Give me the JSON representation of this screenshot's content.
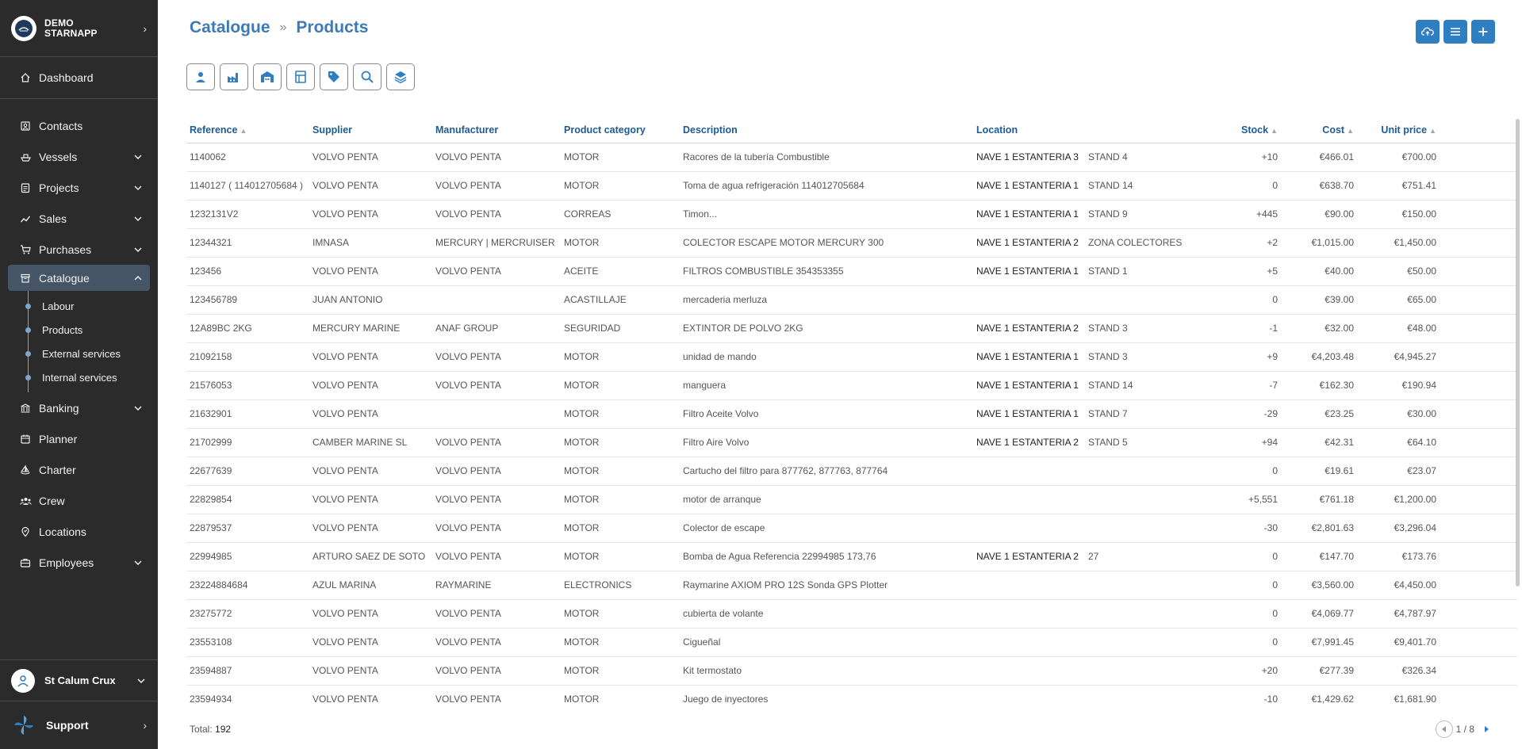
{
  "brand": {
    "name_line1": "DEMO",
    "name_line2": "STARNAPP"
  },
  "nav": {
    "dashboard": "Dashboard",
    "contacts": "Contacts",
    "vessels": "Vessels",
    "projects": "Projects",
    "sales": "Sales",
    "purchases": "Purchases",
    "catalogue": "Catalogue",
    "catalogue_sub": [
      "Labour",
      "Products",
      "External services",
      "Internal services"
    ],
    "banking": "Banking",
    "planner": "Planner",
    "charter": "Charter",
    "crew": "Crew",
    "locations": "Locations",
    "employees": "Employees"
  },
  "user": {
    "name": "St Calum Crux"
  },
  "support": {
    "label": "Support"
  },
  "breadcrumb": {
    "parent": "Catalogue",
    "current": "Products"
  },
  "table": {
    "columns": {
      "reference": "Reference",
      "supplier": "Supplier",
      "manufacturer": "Manufacturer",
      "category": "Product category",
      "description": "Description",
      "location": "Location",
      "stock": "Stock",
      "cost": "Cost",
      "unit_price": "Unit price"
    },
    "rows": [
      {
        "ref": "1140062",
        "sup": "VOLVO PENTA",
        "man": "VOLVO PENTA",
        "cat": "MOTOR",
        "desc": "Racores de la tubería Combustible",
        "loc": "NAVE 1 ESTANTERIA 3",
        "stand": "STAND 4",
        "stock": "+10",
        "cost": "€466.01",
        "price": "€700.00"
      },
      {
        "ref": "1140127 ( 114012705684 )",
        "sup": "VOLVO PENTA",
        "man": "VOLVO PENTA",
        "cat": "MOTOR",
        "desc": "Toma de agua refrigeración 114012705684",
        "loc": "NAVE 1 ESTANTERIA 1",
        "stand": "STAND 14",
        "stock": "0",
        "cost": "€638.70",
        "price": "€751.41"
      },
      {
        "ref": "1232131V2",
        "sup": "VOLVO PENTA",
        "man": "VOLVO PENTA",
        "cat": "CORREAS",
        "desc": "Timon...",
        "loc": "NAVE 1 ESTANTERIA 1",
        "stand": "STAND 9",
        "stock": "+445",
        "cost": "€90.00",
        "price": "€150.00"
      },
      {
        "ref": "12344321",
        "sup": "IMNASA",
        "man": "MERCURY | MERCRUISER",
        "cat": "MOTOR",
        "desc": "COLECTOR ESCAPE MOTOR MERCURY 300",
        "loc": "NAVE 1 ESTANTERIA 2",
        "stand": "ZONA COLECTORES",
        "stock": "+2",
        "cost": "€1,015.00",
        "price": "€1,450.00"
      },
      {
        "ref": "123456",
        "sup": "VOLVO PENTA",
        "man": "VOLVO PENTA",
        "cat": "ACEITE",
        "desc": "FILTROS COMBUSTIBLE 354353355",
        "loc": "NAVE 1 ESTANTERIA 1",
        "stand": "STAND 1",
        "stock": "+5",
        "cost": "€40.00",
        "price": "€50.00"
      },
      {
        "ref": "123456789",
        "sup": "JUAN ANTONIO",
        "man": "",
        "cat": "ACASTILLAJE",
        "desc": "mercaderia merluza",
        "loc": "",
        "stand": "",
        "stock": "0",
        "cost": "€39.00",
        "price": "€65.00"
      },
      {
        "ref": "12A89BC 2KG",
        "sup": "MERCURY MARINE",
        "man": "ANAF GROUP",
        "cat": "SEGURIDAD",
        "desc": "EXTINTOR DE POLVO 2KG",
        "loc": "NAVE 1 ESTANTERIA 2",
        "stand": "STAND 3",
        "stock": "-1",
        "cost": "€32.00",
        "price": "€48.00"
      },
      {
        "ref": "21092158",
        "sup": "VOLVO PENTA",
        "man": "VOLVO PENTA",
        "cat": "MOTOR",
        "desc": "unidad de mando",
        "loc": "NAVE 1 ESTANTERIA 1",
        "stand": "STAND 3",
        "stock": "+9",
        "cost": "€4,203.48",
        "price": "€4,945.27"
      },
      {
        "ref": "21576053",
        "sup": "VOLVO PENTA",
        "man": "VOLVO PENTA",
        "cat": "MOTOR",
        "desc": "manguera",
        "loc": "NAVE 1 ESTANTERIA 1",
        "stand": "STAND 14",
        "stock": "-7",
        "cost": "€162.30",
        "price": "€190.94"
      },
      {
        "ref": "21632901",
        "sup": "VOLVO PENTA",
        "man": "",
        "cat": "MOTOR",
        "desc": "Filtro Aceite Volvo",
        "loc": "NAVE 1 ESTANTERIA 1",
        "stand": "STAND 7",
        "stock": "-29",
        "cost": "€23.25",
        "price": "€30.00"
      },
      {
        "ref": "21702999",
        "sup": "CAMBER MARINE SL",
        "man": "VOLVO PENTA",
        "cat": "MOTOR",
        "desc": "Filtro Aire Volvo",
        "loc": "NAVE 1 ESTANTERIA 2",
        "stand": "STAND 5",
        "stock": "+94",
        "cost": "€42.31",
        "price": "€64.10"
      },
      {
        "ref": "22677639",
        "sup": "VOLVO PENTA",
        "man": "VOLVO PENTA",
        "cat": "MOTOR",
        "desc": "Cartucho del filtro para 877762, 877763, 877764",
        "loc": "",
        "stand": "",
        "stock": "0",
        "cost": "€19.61",
        "price": "€23.07"
      },
      {
        "ref": "22829854",
        "sup": "VOLVO PENTA",
        "man": "VOLVO PENTA",
        "cat": "MOTOR",
        "desc": "motor de arranque",
        "loc": "",
        "stand": "",
        "stock": "+5,551",
        "cost": "€761.18",
        "price": "€1,200.00"
      },
      {
        "ref": "22879537",
        "sup": "VOLVO PENTA",
        "man": "VOLVO PENTA",
        "cat": "MOTOR",
        "desc": "Colector de escape",
        "loc": "",
        "stand": "",
        "stock": "-30",
        "cost": "€2,801.63",
        "price": "€3,296.04"
      },
      {
        "ref": "22994985",
        "sup": "ARTURO SAEZ DE SOTO",
        "man": "VOLVO PENTA",
        "cat": "MOTOR",
        "desc": "Bomba de Agua Referencia 22994985 173,76",
        "loc": "NAVE 1 ESTANTERIA 2",
        "stand": "27",
        "stock": "0",
        "cost": "€147.70",
        "price": "€173.76"
      },
      {
        "ref": "23224884684",
        "sup": "AZUL MARINA",
        "man": "RAYMARINE",
        "cat": "ELECTRONICS",
        "desc": "Raymarine AXIOM PRO 12S Sonda GPS Plotter",
        "loc": "",
        "stand": "",
        "stock": "0",
        "cost": "€3,560.00",
        "price": "€4,450.00"
      },
      {
        "ref": "23275772",
        "sup": "VOLVO PENTA",
        "man": "VOLVO PENTA",
        "cat": "MOTOR",
        "desc": "cubierta de volante",
        "loc": "",
        "stand": "",
        "stock": "0",
        "cost": "€4,069.77",
        "price": "€4,787.97"
      },
      {
        "ref": "23553108",
        "sup": "VOLVO PENTA",
        "man": "VOLVO PENTA",
        "cat": "MOTOR",
        "desc": "Cigueñal",
        "loc": "",
        "stand": "",
        "stock": "0",
        "cost": "€7,991.45",
        "price": "€9,401.70"
      },
      {
        "ref": "23594887",
        "sup": "VOLVO PENTA",
        "man": "VOLVO PENTA",
        "cat": "MOTOR",
        "desc": "Kit termostato",
        "loc": "",
        "stand": "",
        "stock": "+20",
        "cost": "€277.39",
        "price": "€326.34"
      },
      {
        "ref": "23594934",
        "sup": "VOLVO PENTA",
        "man": "VOLVO PENTA",
        "cat": "MOTOR",
        "desc": "Juego de inyectores",
        "loc": "",
        "stand": "",
        "stock": "-10",
        "cost": "€1,429.62",
        "price": "€1,681.90"
      }
    ]
  },
  "footer": {
    "total_label": "Total:",
    "total_value": "192",
    "page": "1 / 8"
  },
  "colors": {
    "sidebar": "#2b2b2b",
    "accent": "#2e7ec1",
    "header_text": "#1d5c94"
  }
}
